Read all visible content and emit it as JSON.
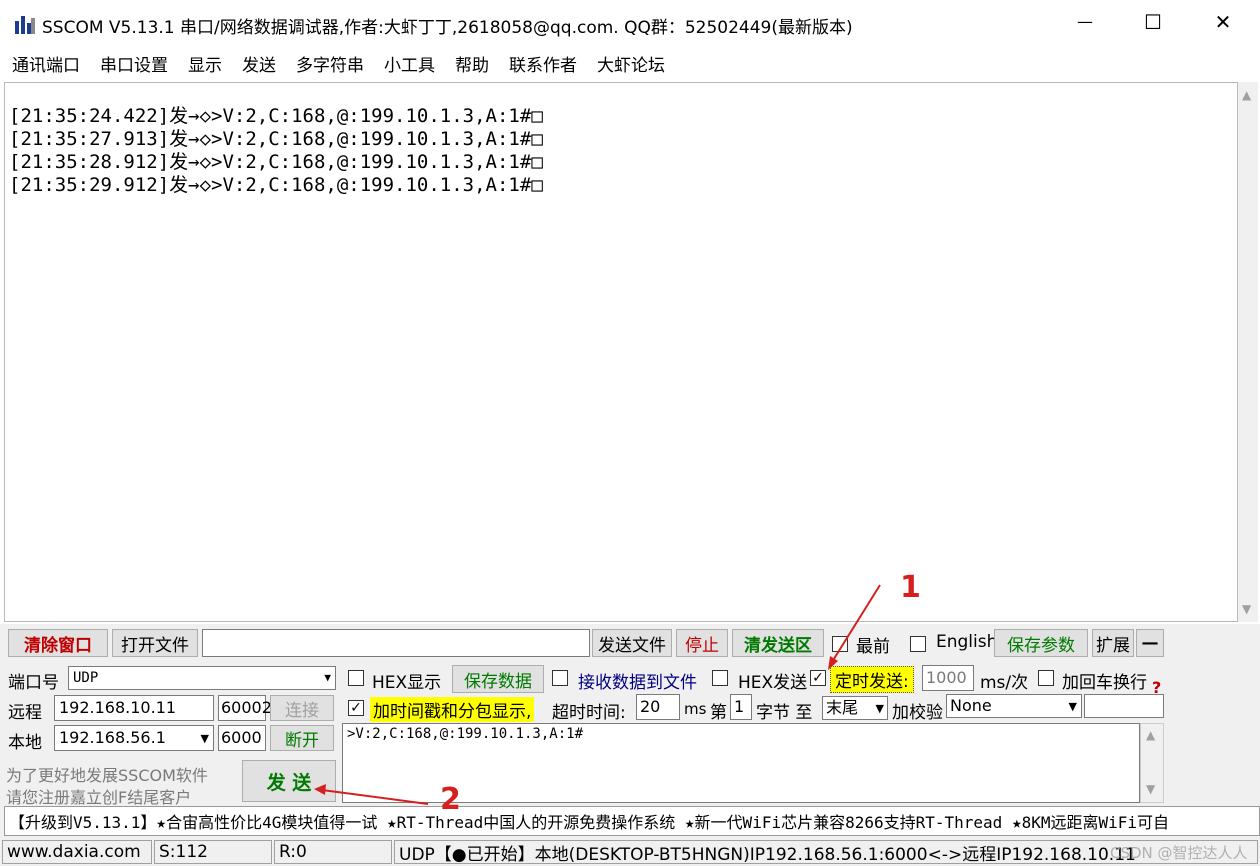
{
  "window": {
    "title": "SSCOM V5.13.1 串口/网络数据调试器,作者:大虾丁丁,2618058@qq.com. QQ群：52502449(最新版本)",
    "minimize": "—",
    "maximize": "☐",
    "close": "✕"
  },
  "menu": [
    "通讯端口",
    "串口设置",
    "显示",
    "发送",
    "多字符串",
    "小工具",
    "帮助",
    "联系作者",
    "大虾论坛"
  ],
  "receive": {
    "lines": [
      "[21:35:24.422]发→◇>V:2,C:168,@:199.10.1.3,A:1#□",
      "[21:35:27.913]发→◇>V:2,C:168,@:199.10.1.3,A:1#□",
      "[21:35:28.912]发→◇>V:2,C:168,@:199.10.1.3,A:1#□",
      "[21:35:29.912]发→◇>V:2,C:168,@:199.10.1.3,A:1#□"
    ]
  },
  "toolbar": {
    "clear_window": "清除窗口",
    "open_file": "打开文件",
    "file_path": "",
    "send_file": "发送文件",
    "stop": "停止",
    "clear_send": "清发送区",
    "topmost": "最前",
    "english": "English",
    "save_params": "保存参数",
    "expand": "扩展",
    "collapse": "—"
  },
  "port": {
    "port_label": "端口号",
    "port_value": "UDP",
    "remote_label": "远程",
    "remote_ip": "192.168.10.11",
    "remote_port": "60002",
    "connect": "连接",
    "local_label": "本地",
    "local_ip": "192.168.56.1",
    "local_port": "6000",
    "disconnect": "断开",
    "promo_line1": "为了更好地发展SSCOM软件",
    "promo_line2": "请您注册嘉立创F结尾客户",
    "send": "发  送"
  },
  "options": {
    "hex_display": "HEX显示",
    "save_data": "保存数据",
    "recv_to_file": "接收数据到文件",
    "hex_send": "HEX发送",
    "timed_send": "定时发送:",
    "interval": "1000",
    "interval_unit": "ms/次",
    "add_crlf": "加回车换行",
    "timestamp": "加时间戳和分包显示,",
    "timeout_label": "超时时间:",
    "timeout_value": "20",
    "timeout_unit": "ms",
    "nth_label": "第",
    "nth_value": "1",
    "byte_label": "字节 至",
    "end_value": "末尾",
    "checksum_label": "加校验",
    "checksum_value": "None",
    "help_mark": "?"
  },
  "send_box": {
    "content": ">V:2,C:168,@:199.10.1.3,A:1#"
  },
  "ticker": "【升级到V5.13.1】★合宙高性价比4G模块值得一试 ★RT-Thread中国人的开源免费操作系统 ★新一代WiFi芯片兼容8266支持RT-Thread ★8KM远距离WiFi可自",
  "status": {
    "site": "www.daxia.com",
    "sent": "S:112",
    "recv": "R:0",
    "info": "UDP【●已开始】本地(DESKTOP-BT5HNGN)IP192.168.56.1:6000<->远程IP192.168.10.11",
    "watermark": "CSDN @智控达人人"
  },
  "annotations": {
    "marker1": "1",
    "marker2": "2",
    "color": "#d62020"
  }
}
